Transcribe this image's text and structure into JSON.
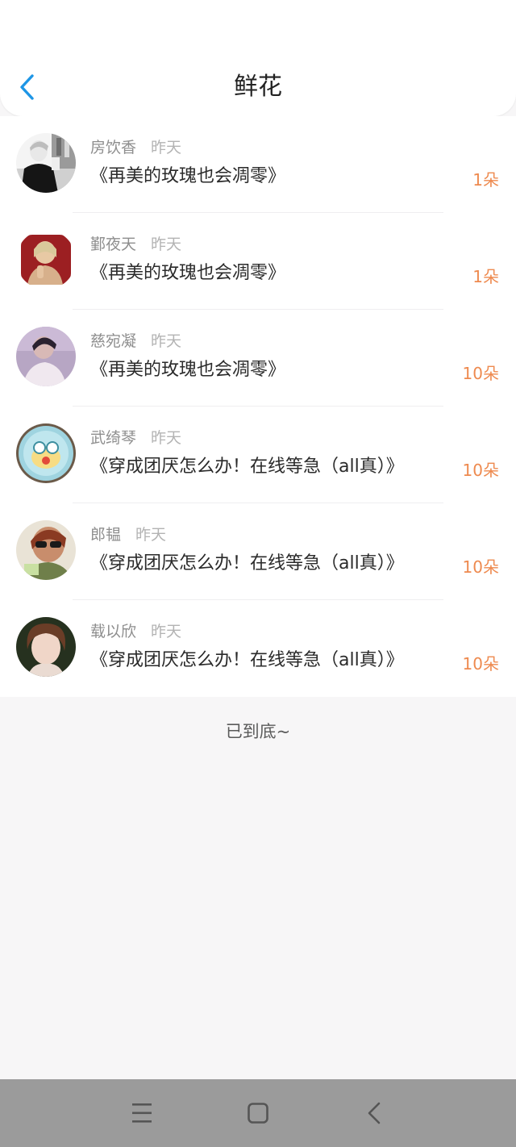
{
  "header": {
    "title": "鲜花",
    "back_icon": "chevron-left-icon",
    "accent_color": "#1e96e6"
  },
  "list": {
    "items": [
      {
        "name": "房饮香",
        "time": "昨天",
        "title": "《再美的玫瑰也会凋零》",
        "count": "1朵",
        "avatar": "avatar-photo"
      },
      {
        "name": "鄞夜天",
        "time": "昨天",
        "title": "《再美的玫瑰也会凋零》",
        "count": "1朵",
        "avatar": "avatar-photo"
      },
      {
        "name": "慈宛凝",
        "time": "昨天",
        "title": "《再美的玫瑰也会凋零》",
        "count": "10朵",
        "avatar": "avatar-photo"
      },
      {
        "name": "武绮琴",
        "time": "昨天",
        "title": "《穿成团厌怎么办！在线等急（all真）》",
        "count": "10朵",
        "avatar": "avatar-photo"
      },
      {
        "name": "郎韫",
        "time": "昨天",
        "title": "《穿成团厌怎么办！在线等急（all真）》",
        "count": "10朵",
        "avatar": "avatar-photo"
      },
      {
        "name": "载以欣",
        "time": "昨天",
        "title": "《穿成团厌怎么办！在线等急（all真）》",
        "count": "10朵",
        "avatar": "avatar-photo"
      }
    ],
    "count_color": "#ee8a4f"
  },
  "footer": {
    "end_text": "已到底~"
  },
  "navbar": {
    "menu_icon": "menu-icon",
    "home_icon": "home-square-icon",
    "back_icon": "back-arrow-icon"
  }
}
